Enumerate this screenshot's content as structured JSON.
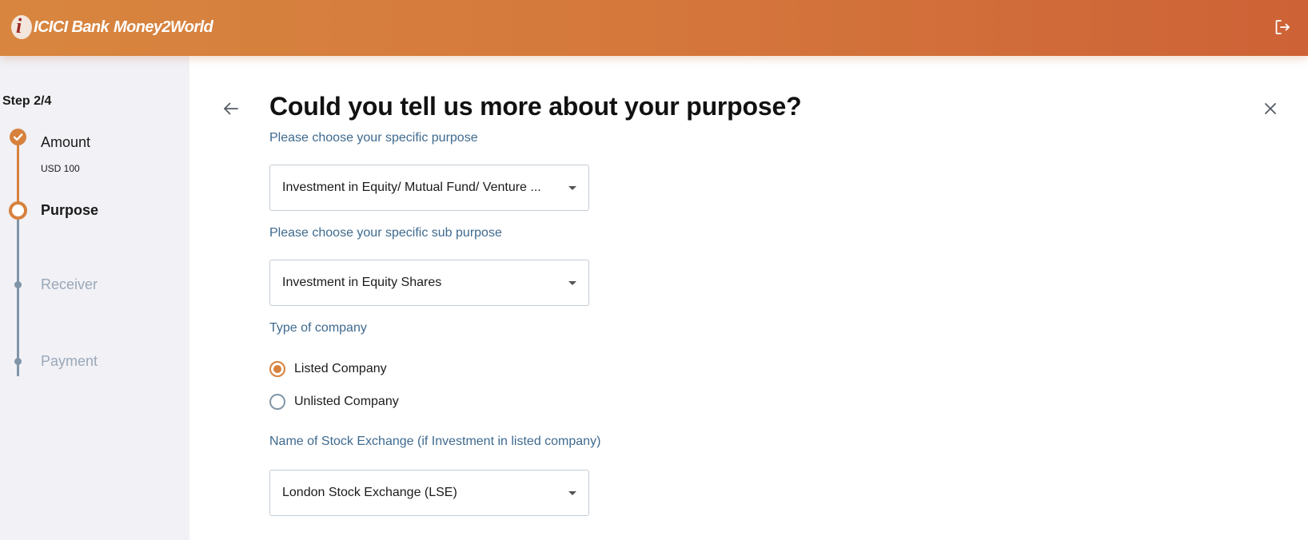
{
  "header": {
    "logo_mark": "i",
    "logo_bank": "ICICI Bank",
    "logo_product": "Money2World",
    "logout_icon": "logout-icon"
  },
  "sidebar": {
    "step_count": "Step 2/4",
    "steps": [
      {
        "label": "Amount",
        "sub": "USD 100",
        "state": "done"
      },
      {
        "label": "Purpose",
        "state": "current"
      },
      {
        "label": "Receiver",
        "state": "todo"
      },
      {
        "label": "Payment",
        "state": "todo"
      }
    ]
  },
  "main": {
    "title": "Could you tell us more about your purpose?",
    "purpose": {
      "label": "Please choose your specific purpose",
      "value": "Investment in Equity/ Mutual Fund/ Venture ..."
    },
    "sub_purpose": {
      "label": "Please choose your specific sub purpose",
      "value": "Investment in Equity Shares"
    },
    "company_type": {
      "label": "Type of company",
      "options": [
        {
          "label": "Listed Company",
          "selected": true
        },
        {
          "label": "Unlisted Company",
          "selected": false
        }
      ]
    },
    "stock_exchange": {
      "label": "Name of Stock Exchange (if Investment in listed company)",
      "value": "London Stock Exchange (LSE)"
    }
  },
  "colors": {
    "accent": "#d7813d",
    "label_blue": "#3f6a8f",
    "inactive": "#8195a8",
    "sidebar_bg": "#f1f1f6"
  }
}
